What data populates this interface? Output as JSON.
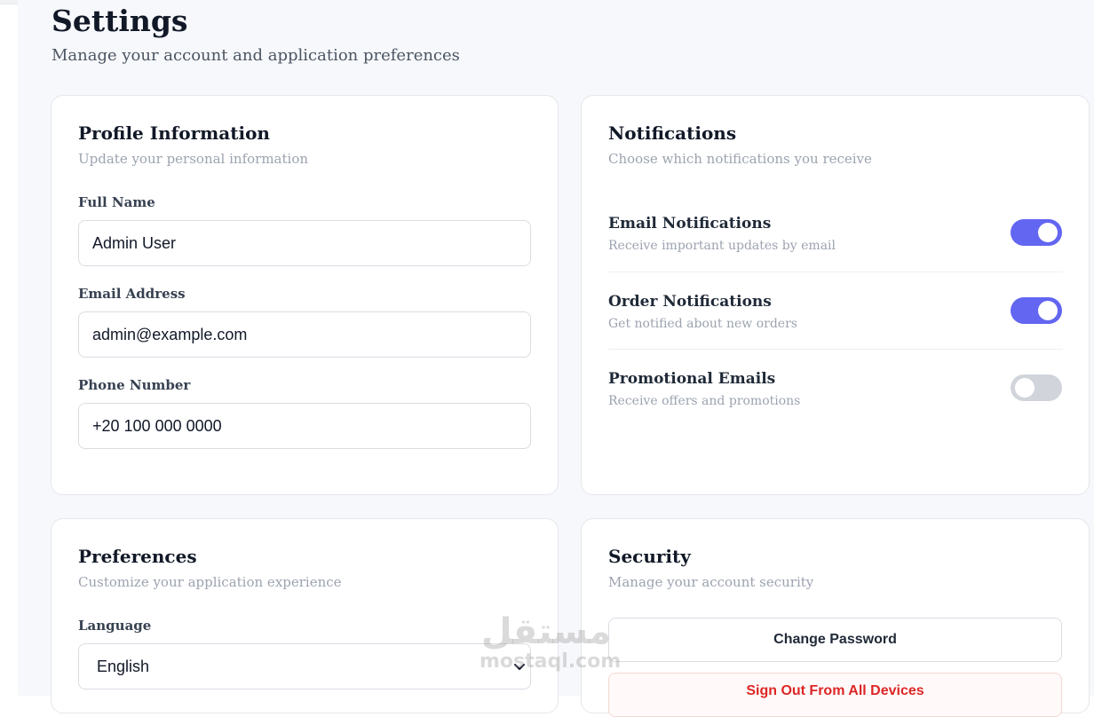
{
  "header": {
    "title": "Settings",
    "subtitle": "Manage your account and application preferences"
  },
  "profile": {
    "title": "Profile Information",
    "subtitle": "Update your personal information",
    "full_name_label": "Full Name",
    "full_name_value": "Admin User",
    "email_label": "Email Address",
    "email_value": "admin@example.com",
    "phone_label": "Phone Number",
    "phone_value": "+20 100 000 0000"
  },
  "notifications": {
    "title": "Notifications",
    "subtitle": "Choose which notifications you receive",
    "items": [
      {
        "title": "Email Notifications",
        "subtitle": "Receive important updates by email",
        "enabled": true
      },
      {
        "title": "Order Notifications",
        "subtitle": "Get notified about new orders",
        "enabled": true
      },
      {
        "title": "Promotional Emails",
        "subtitle": "Receive offers and promotions",
        "enabled": false
      }
    ]
  },
  "preferences": {
    "title": "Preferences",
    "subtitle": "Customize your application experience",
    "language_label": "Language",
    "language_value": "English"
  },
  "security": {
    "title": "Security",
    "subtitle": "Manage your account security",
    "change_password_label": "Change Password",
    "sign_out_all_label": "Sign Out From All Devices"
  },
  "watermark": {
    "arabic": "مستقل",
    "latin": "mostaql.com"
  },
  "colors": {
    "accent": "#6366f1",
    "toggle_off": "#d1d5db",
    "danger": "#dc2626"
  }
}
